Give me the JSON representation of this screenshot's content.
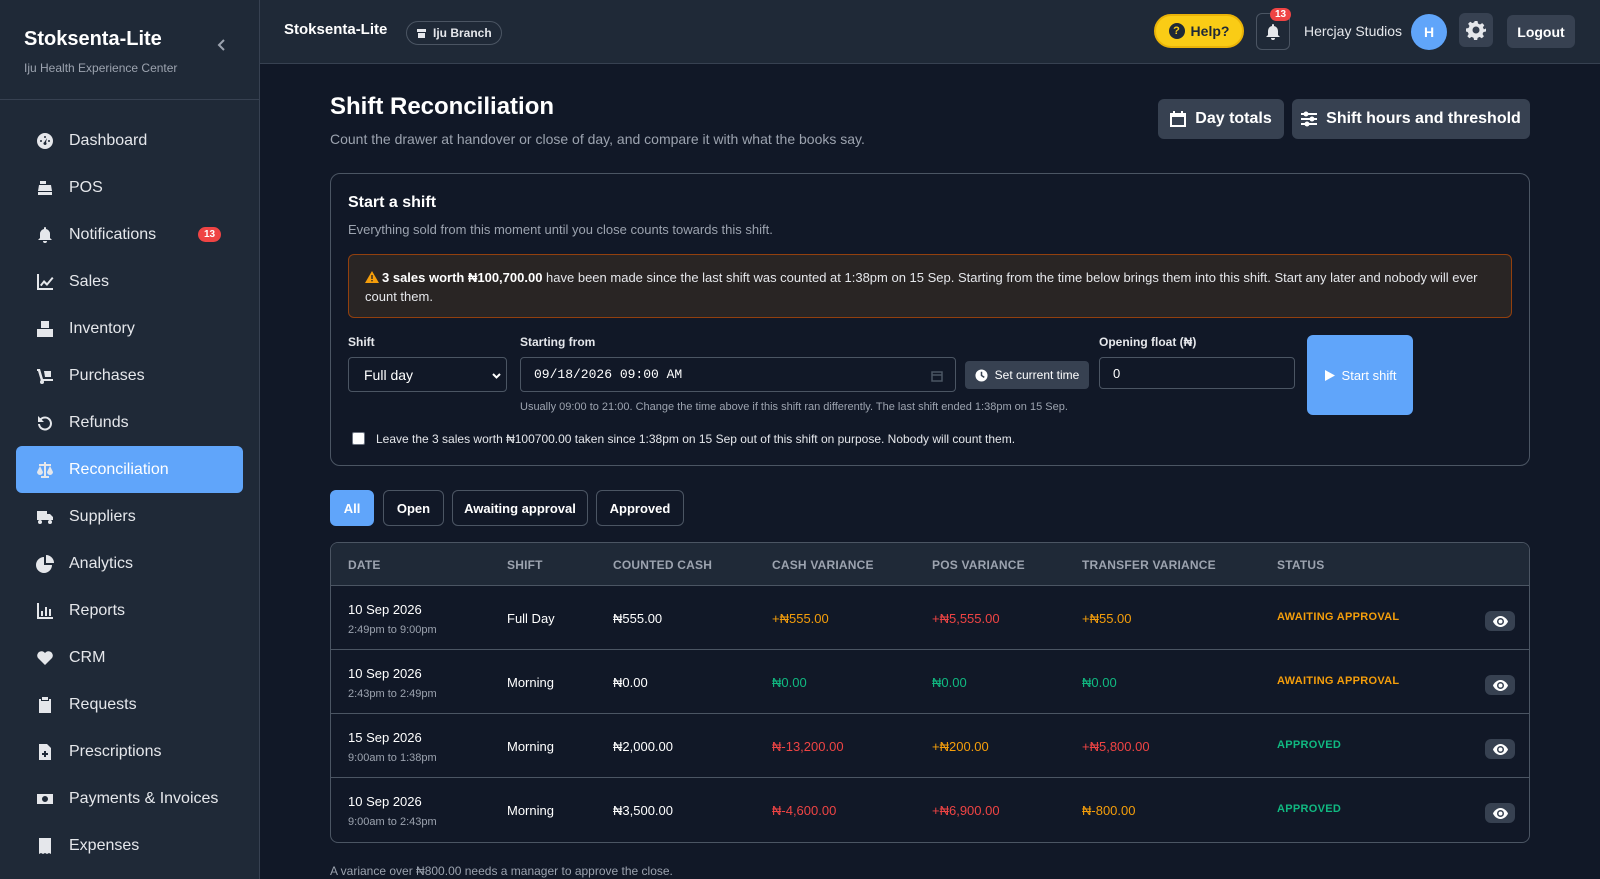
{
  "sidebar": {
    "brand_title": "Stoksenta-Lite",
    "brand_subtitle": "Iju Health Experience Center",
    "items": [
      {
        "label": "Dashboard",
        "icon": "gauge-icon"
      },
      {
        "label": "POS",
        "icon": "cash-register-icon"
      },
      {
        "label": "Notifications",
        "icon": "bell-icon",
        "badge": "13"
      },
      {
        "label": "Sales",
        "icon": "chart-line-icon"
      },
      {
        "label": "Inventory",
        "icon": "boxes-icon"
      },
      {
        "label": "Purchases",
        "icon": "dolly-icon"
      },
      {
        "label": "Refunds",
        "icon": "undo-icon"
      },
      {
        "label": "Reconciliation",
        "icon": "scale-icon",
        "active": true
      },
      {
        "label": "Suppliers",
        "icon": "truck-icon"
      },
      {
        "label": "Analytics",
        "icon": "pie-chart-icon"
      },
      {
        "label": "Reports",
        "icon": "bar-chart-icon"
      },
      {
        "label": "CRM",
        "icon": "heart-pulse-icon"
      },
      {
        "label": "Requests",
        "icon": "clipboard-icon"
      },
      {
        "label": "Prescriptions",
        "icon": "file-medical-icon"
      },
      {
        "label": "Payments & Invoices",
        "icon": "money-bill-icon"
      },
      {
        "label": "Expenses",
        "icon": "receipt-icon"
      }
    ]
  },
  "topbar": {
    "title": "Stoksenta-Lite",
    "branch": "Iju Branch",
    "help_label": "Help?",
    "notification_count": "13",
    "user_name": "Hercjay Studios",
    "avatar_initial": "H",
    "logout_label": "Logout"
  },
  "header": {
    "title": "Shift Reconciliation",
    "subtitle": "Count the drawer at handover or close of day, and compare it with what the books say.",
    "day_totals_label": "Day totals",
    "shift_hours_label": "Shift hours and threshold"
  },
  "start_shift": {
    "title": "Start a shift",
    "subtitle": "Everything sold from this moment until you close counts towards this shift.",
    "warning_bold": "3 sales worth ₦100,700.00",
    "warning_text": " have been made since the last shift was counted at 1:38pm on 15 Sep. Starting from the time below brings them into this shift. Start any later and nobody will ever count them.",
    "shift_label": "Shift",
    "shift_value": "Full day",
    "starting_label": "Starting from",
    "starting_value": "09/18/2026 09:00 AM",
    "set_time_label": "Set current time",
    "hint": "Usually 09:00 to 21:00. Change the time above if this shift ran differently. The last shift ended 1:38pm on 15 Sep.",
    "float_label": "Opening float (₦)",
    "float_value": "0",
    "start_label": "Start shift",
    "checkbox_label": "Leave the 3 sales worth ₦100700.00 taken since 1:38pm on 15 Sep out of this shift on purpose. Nobody will count them."
  },
  "filters": [
    "All",
    "Open",
    "Awaiting approval",
    "Approved"
  ],
  "table": {
    "headers": [
      "DATE",
      "SHIFT",
      "COUNTED CASH",
      "CASH VARIANCE",
      "POS VARIANCE",
      "TRANSFER VARIANCE",
      "STATUS"
    ],
    "rows": [
      {
        "date": "10 Sep 2026",
        "time": "2:49pm to 9:00pm",
        "shift": "Full Day",
        "counted": "₦555.00",
        "cash_var": "+₦555.00",
        "pos_var": "+₦5,555.00",
        "transfer_var": "+₦55.00",
        "status": "AWAITING APPROVAL"
      },
      {
        "date": "10 Sep 2026",
        "time": "2:43pm to 2:49pm",
        "shift": "Morning",
        "counted": "₦0.00",
        "cash_var": "₦0.00",
        "pos_var": "₦0.00",
        "transfer_var": "₦0.00",
        "status": "AWAITING APPROVAL"
      },
      {
        "date": "15 Sep 2026",
        "time": "9:00am to 1:38pm",
        "shift": "Morning",
        "counted": "₦2,000.00",
        "cash_var": "₦-13,200.00",
        "pos_var": "+₦200.00",
        "transfer_var": "+₦5,800.00",
        "status": "APPROVED"
      },
      {
        "date": "10 Sep 2026",
        "time": "9:00am to 2:43pm",
        "shift": "Morning",
        "counted": "₦3,500.00",
        "cash_var": "₦-4,600.00",
        "pos_var": "+₦6,900.00",
        "transfer_var": "₦-800.00",
        "status": "APPROVED"
      }
    ]
  },
  "footnote": "A variance over ₦800.00 needs a manager to approve the close.",
  "colors": {
    "accent": "#60a5fa",
    "orange": "#f59e0b",
    "red": "#ef4444",
    "green": "#10b981",
    "status_awaiting": "#f59e0b",
    "status_approved": "#10b981"
  }
}
